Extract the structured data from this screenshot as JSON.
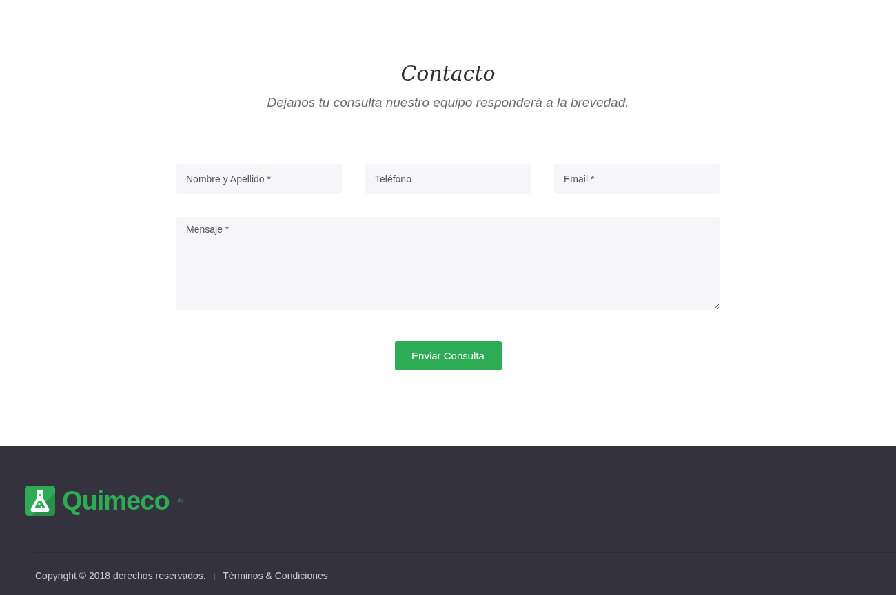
{
  "contact": {
    "title": "Contacto",
    "subtitle": "Dejanos tu consulta nuestro equipo responderá a la brevedad.",
    "fields": [
      {
        "placeholder": "Nombre y Apellido *"
      },
      {
        "placeholder": "Teléfono"
      },
      {
        "placeholder": "Email *"
      }
    ],
    "message": {
      "placeholder": "Mensaje *"
    },
    "submit": "Enviar Consulta"
  },
  "footer": {
    "logo": {
      "name": "Quimeco",
      "mark": "®"
    },
    "copyright": "Copyright © 2018 derechos reservados.",
    "separator": "|",
    "terms_link": "Términos & Condiciones"
  }
}
